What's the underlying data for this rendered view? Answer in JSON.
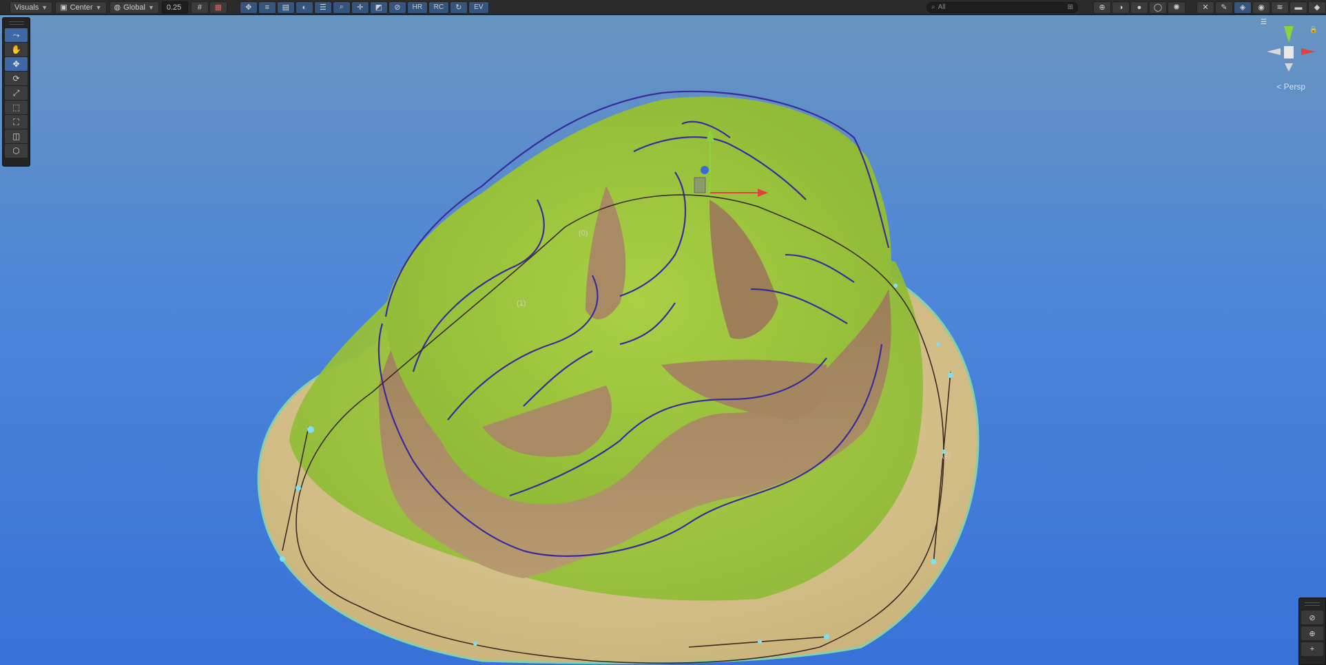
{
  "toolbar": {
    "visuals_label": "Visuals",
    "pivot_label": "Center",
    "space_label": "Global",
    "snap_value": "0.25",
    "text_buttons": [
      "HR",
      "RC",
      "EV"
    ],
    "search_placeholder": "All"
  },
  "tools": [
    "path-tool",
    "hand-tool",
    "move-tool",
    "rotate-tool",
    "scale-tool",
    "rect-tool",
    "transform-tool",
    "custom-tool-1",
    "custom-tool-2"
  ],
  "scene": {
    "terrain_labels": [
      "(0)",
      "(1)",
      "(2)"
    ],
    "accent_colors": {
      "sky": "#3c7ad6",
      "grass": "#9bc53b",
      "cliff": "#a68a62",
      "sand": "#d9c995",
      "spline": "#3a2a9c",
      "outer_spline": "#3a2a20"
    }
  },
  "gizmo": {
    "projection_label": "< Persp",
    "axes": [
      "y",
      "x",
      "z"
    ],
    "axis_colors": {
      "x": "#e0433b",
      "y": "#8bd23b",
      "z": "#3b7ad6"
    }
  }
}
